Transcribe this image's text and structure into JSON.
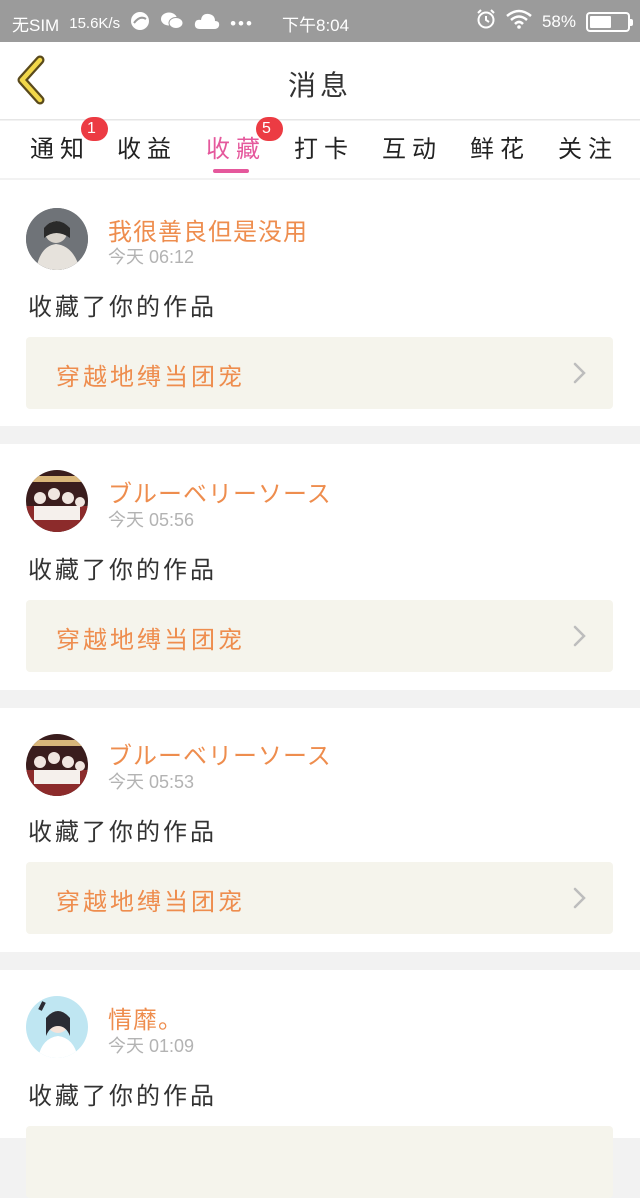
{
  "status_bar": {
    "carrier": "无SIM",
    "speed": "15.6K/s",
    "time": "下午8:04",
    "battery": "58%",
    "battery_level": 0.58
  },
  "header": {
    "title": "消息",
    "back_icon": "chevron-left-icon"
  },
  "tabs": [
    {
      "label": "通知",
      "badge": "1"
    },
    {
      "label": "收益",
      "badge": ""
    },
    {
      "label": "收藏",
      "badge": "5",
      "active": true
    },
    {
      "label": "打卡",
      "badge": ""
    },
    {
      "label": "互动",
      "badge": ""
    },
    {
      "label": "鲜花",
      "badge": ""
    },
    {
      "label": "关注",
      "badge": ""
    }
  ],
  "items": [
    {
      "user": "我很善良但是没用",
      "time": "今天 06:12",
      "action": "收藏了你的作品",
      "work": "穿越地缚当团宠"
    },
    {
      "user": "ブルーベリーソース",
      "time": "今天 05:56",
      "action": "收藏了你的作品",
      "work": "穿越地缚当团宠"
    },
    {
      "user": "ブルーベリーソース",
      "time": "今天 05:53",
      "action": "收藏了你的作品",
      "work": "穿越地缚当团宠"
    },
    {
      "user": "情靡。",
      "time": "今天 01:09",
      "action": "收藏了你的作品",
      "work": ""
    }
  ],
  "colors": {
    "accent": "#e5589c",
    "name": "#ee8d4e",
    "badge": "#ec3b43",
    "card_bg": "#f5f4ec"
  }
}
